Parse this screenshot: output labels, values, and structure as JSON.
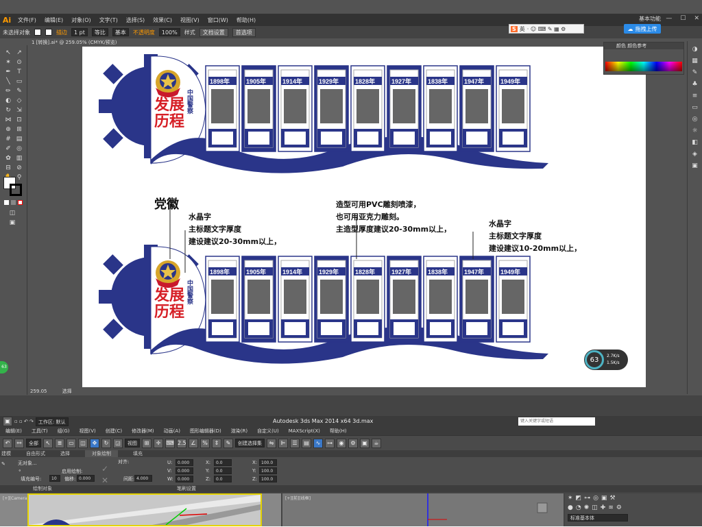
{
  "illustrator": {
    "logo": "Ai",
    "menu": [
      "文件(F)",
      "编辑(E)",
      "对象(O)",
      "文字(T)",
      "选择(S)",
      "效果(C)",
      "视图(V)",
      "窗口(W)",
      "帮助(H)"
    ],
    "workspace": "基本功能",
    "control": {
      "selection": "未选择对象",
      "stroke_label": "描边",
      "stroke_value": "1 pt",
      "stroke_style": "等比",
      "brush": "基本",
      "opacity_label": "不透明度",
      "opacity_value": "100%",
      "style_label": "样式",
      "doc_setup": "文档设置",
      "preferences": "首选项"
    },
    "doc_tab": "1 [转换].ai* @ 259.05% (CMYK/预览)",
    "color_panel_tabs": "颜色  颜色参考",
    "status_zoom": "259.05",
    "status_tool": "选择",
    "ime_bar": {
      "logo": "S",
      "lang": "英"
    },
    "upload_btn": "拖拽上传"
  },
  "design": {
    "title_line1": "发展",
    "title_line2": "历程",
    "vertical_title": "中国警察",
    "years": [
      "1898年",
      "1905年",
      "1914年",
      "1929年",
      "1828年",
      "1927年",
      "1838年",
      "1947年",
      "1949年"
    ]
  },
  "notes": {
    "party_emblem": "党徽",
    "crystal1": [
      "水晶字",
      "主标题文字厚度",
      "建设建议20-30mm以上，"
    ],
    "pvc": [
      "造型可用PVC雕刻喷漆，",
      "也可用亚克力雕刻。",
      "主造型厚度建议20-30mm以上，"
    ],
    "crystal2": [
      "水晶字",
      "主标题文字厚度",
      "建设建议10-20mm以上，"
    ]
  },
  "speed_widget": {
    "percent": "63",
    "up": "2.7K/s",
    "down": "1.5K/s"
  },
  "side_badge": "63",
  "max": {
    "app_title": "Autodesk 3ds Max  2014 x64      3d.max",
    "workspace": "工作区: 默认",
    "search_placeholder": "键入关键字或短语",
    "menu": [
      "编辑(E)",
      "工具(T)",
      "组(G)",
      "视图(V)",
      "创建(C)",
      "修改器(M)",
      "动画(A)",
      "图形编辑器(D)",
      "渲染(R)",
      "自定义(U)",
      "MAXScript(X)",
      "帮助(H)"
    ],
    "toolbar_select": "全部",
    "view_select": "视图",
    "named_sel": "创建选择集",
    "tabs": [
      "建模",
      "自由形式",
      "选择",
      "对象绘制",
      "填充"
    ],
    "active_tab": "对象绘制",
    "ribbon": {
      "nothing_selected": "无对象...",
      "align": "对齐:",
      "fill_num_label": "填充编号:",
      "fill_num": "10",
      "offset_label": "偏移:",
      "offset": "0.000",
      "enable_paint": "启用绘制:",
      "spacing_label": "间距:",
      "spacing": "4.000",
      "u_val": "0.000",
      "v_val": "0.000",
      "w_val": "0.000",
      "x_val": "0.0",
      "y_val": "0.0",
      "z_val": "0.0",
      "x2": "100.0",
      "y2": "100.0",
      "z2": "100.0",
      "footer_left": "绘制对象",
      "footer_right": "笔刷设置"
    },
    "vp_left_label": "[+][Camera001][真实]",
    "vp_right_label": "[+][前][线框]",
    "std_primitives": "标准基本体"
  }
}
